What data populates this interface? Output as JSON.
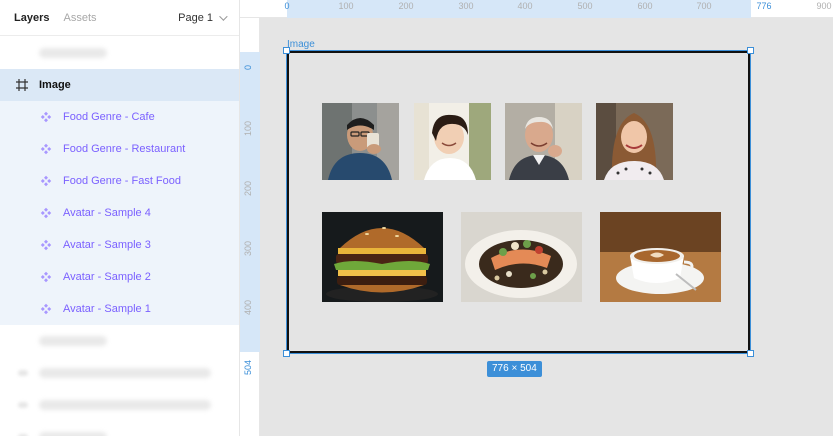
{
  "panel": {
    "tabs": [
      {
        "label": "Layers"
      },
      {
        "label": "Assets"
      }
    ],
    "page": {
      "label": "Page 1"
    }
  },
  "layers": {
    "frame": {
      "label": "Image"
    },
    "components": [
      {
        "label": "Food Genre - Cafe"
      },
      {
        "label": "Food Genre - Restaurant"
      },
      {
        "label": "Food Genre - Fast Food"
      },
      {
        "label": "Avatar - Sample 4"
      },
      {
        "label": "Avatar - Sample 3"
      },
      {
        "label": "Avatar - Sample 2"
      },
      {
        "label": "Avatar - Sample 1"
      }
    ]
  },
  "ruler": {
    "top_ticks": [
      "0",
      "100",
      "200",
      "300",
      "400",
      "500",
      "600",
      "700",
      "776",
      "900"
    ],
    "left_ticks": [
      "0",
      "100",
      "200",
      "300",
      "400",
      "504"
    ]
  },
  "canvas": {
    "frame_title": "Image",
    "size_badge": "776 × 504"
  },
  "colors": {
    "selection": "#3c8fd8",
    "component": "#7b61ff",
    "selected_row": "#dbe8f6"
  }
}
